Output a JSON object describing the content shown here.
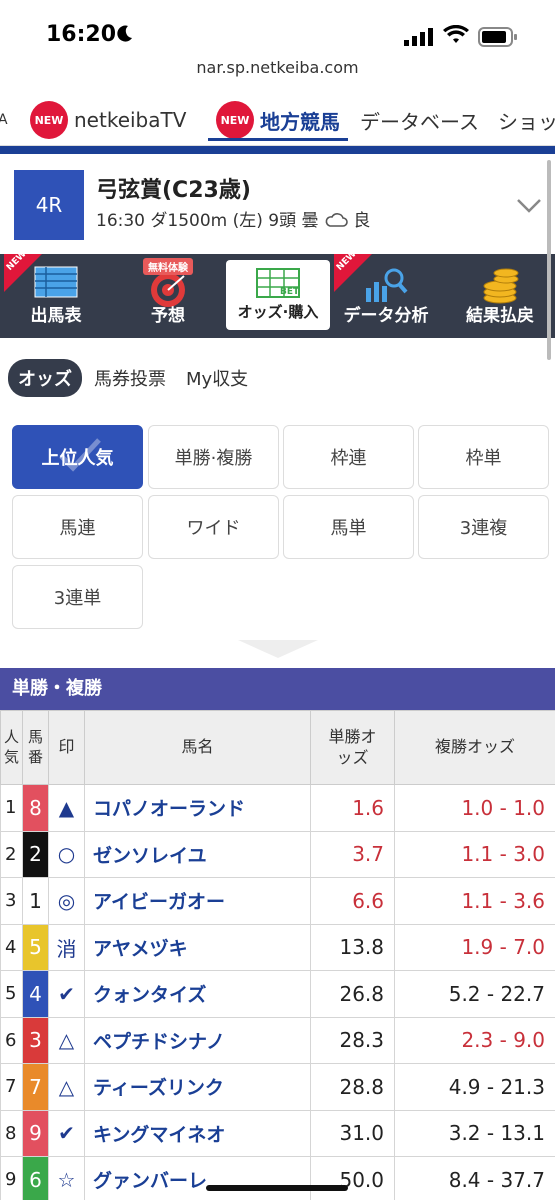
{
  "status": {
    "time": "16:20"
  },
  "url": "nar.sp.netkeiba.com",
  "top_nav": {
    "left_fragment": "A",
    "new_badge": "NEW",
    "tv": "netkeibaTV",
    "local": "地方競馬",
    "database": "データベース",
    "shop": "ショッ"
  },
  "race": {
    "number": "4R",
    "name": "弓弦賞(C23歳)",
    "info": "16:30 ダ1500m (左) 9頭 曇",
    "ground": "良"
  },
  "menu": {
    "items": [
      {
        "label": "出馬表",
        "new": "NEW"
      },
      {
        "label": "予想",
        "tag": "無料体験"
      },
      {
        "label": "オッズ·購入",
        "icon_text": "BET"
      },
      {
        "label": "データ分析",
        "new": "NEW"
      },
      {
        "label": "結果払戻"
      }
    ]
  },
  "sub_tabs": [
    "オッズ",
    "馬券投票",
    "My収支"
  ],
  "odds_buttons": [
    "上位人気",
    "単勝·複勝",
    "枠連",
    "枠単",
    "馬連",
    "ワイド",
    "馬単",
    "3連複",
    "3連単"
  ],
  "section_title": "単勝・複勝",
  "table": {
    "headers": {
      "pop": "人気",
      "num": "馬番",
      "mark": "印",
      "name": "馬名",
      "win": "単勝オッズ",
      "place": "複勝オッズ"
    },
    "rows": [
      {
        "pop": "1",
        "num": "8",
        "color": "#e2505f",
        "mark": "▲",
        "name": "コパノオーランド",
        "win": "1.6",
        "win_red": true,
        "place": "1.0 - 1.0",
        "place_red": true
      },
      {
        "pop": "2",
        "num": "2",
        "color": "#111111",
        "mark": "○",
        "name": "ゼンソレイユ",
        "win": "3.7",
        "win_red": true,
        "place": "1.1 - 3.0",
        "place_red": true
      },
      {
        "pop": "3",
        "num": "1",
        "color": "#ffffff",
        "mark": "◎",
        "name": "アイビーガオー",
        "win": "6.6",
        "win_red": true,
        "place": "1.1 - 3.6",
        "place_red": true
      },
      {
        "pop": "4",
        "num": "5",
        "color": "#e8c52c",
        "mark": "消",
        "name": "アヤメヅキ",
        "win": "13.8",
        "win_red": false,
        "place": "1.9 - 7.0",
        "place_red": true
      },
      {
        "pop": "5",
        "num": "4",
        "color": "#2f52b7",
        "mark": "✔",
        "name": "クォンタイズ",
        "win": "26.8",
        "win_red": false,
        "place": "5.2 - 22.7",
        "place_red": false
      },
      {
        "pop": "6",
        "num": "3",
        "color": "#d93a3a",
        "mark": "△",
        "name": "ペプチドシナノ",
        "win": "28.3",
        "win_red": false,
        "place": "2.3 - 9.0",
        "place_red": true
      },
      {
        "pop": "7",
        "num": "7",
        "color": "#e98a2a",
        "mark": "△",
        "name": "ティーズリンク",
        "win": "28.8",
        "win_red": false,
        "place": "4.9 - 21.3",
        "place_red": false
      },
      {
        "pop": "8",
        "num": "9",
        "color": "#e2505f",
        "mark": "✔",
        "name": "キングマイネオ",
        "win": "31.0",
        "win_red": false,
        "place": "3.2 - 13.1",
        "place_red": false
      },
      {
        "pop": "9",
        "num": "6",
        "color": "#3aa84a",
        "mark": "☆",
        "name": "グァンバーレ",
        "win": "50.0",
        "win_red": false,
        "place": "8.4 - 37.7",
        "place_red": false
      }
    ]
  }
}
